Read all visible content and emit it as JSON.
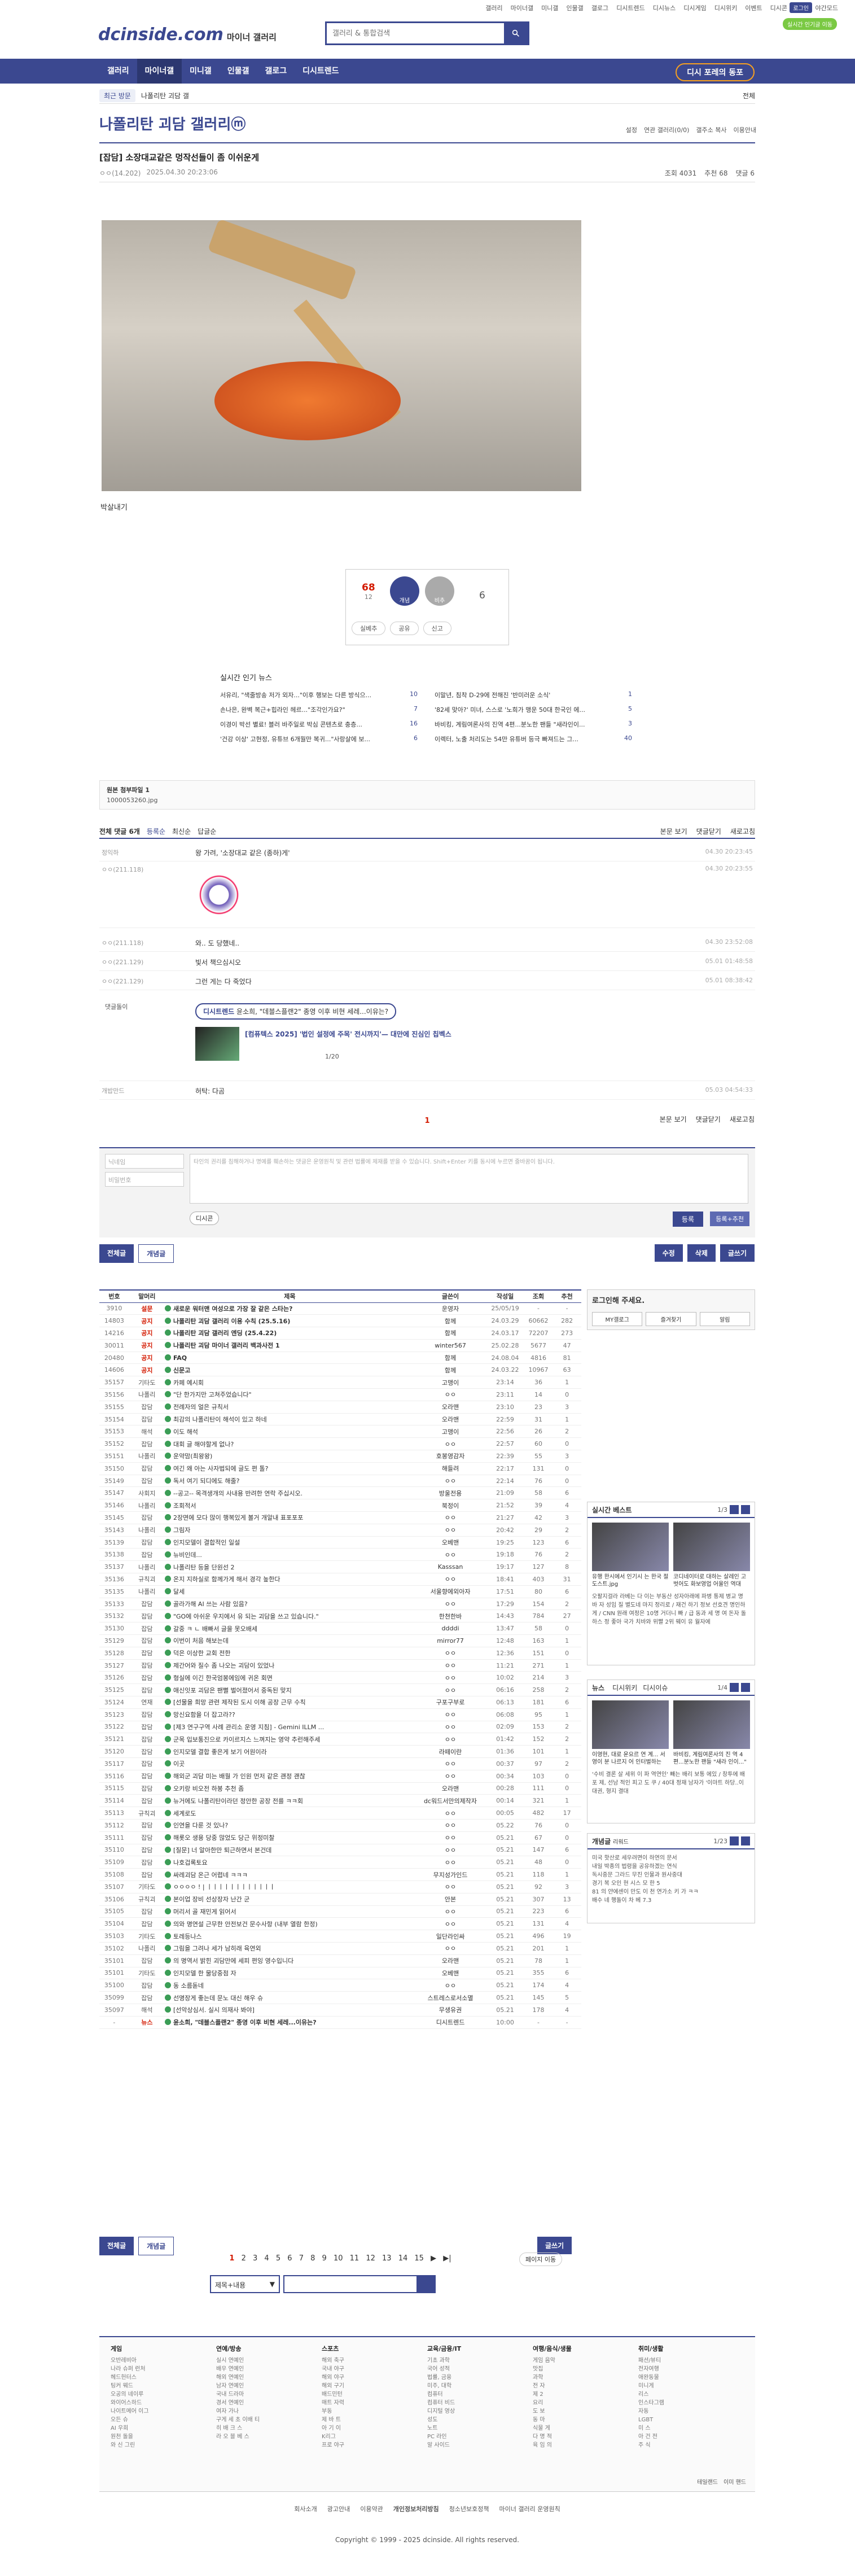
{
  "util": {
    "links": [
      "갤러리",
      "마이너갤",
      "미니갤",
      "인물갤",
      "갤로그",
      "디시트렌드",
      "디시뉴스",
      "디시게임",
      "디시위키",
      "이벤트",
      "디시콘"
    ],
    "login": "로그인",
    "night": "야간모드",
    "promo": "실시간 인기글 이동"
  },
  "logo": {
    "main": "dcinside.com",
    "sub": "마이너 갤러리"
  },
  "search": {
    "placeholder": "갤러리 & 통합검색"
  },
  "gnb": {
    "items": [
      "갤러리",
      "마이너갤",
      "미니갤",
      "인물갤",
      "갤로그",
      "디시트렌드"
    ],
    "sub": "디시 포레의 동포"
  },
  "crumb": {
    "tag": "최근 방문",
    "dropdown": "나폴리탄 괴담 갤",
    "right": "전체"
  },
  "gallery": {
    "title": "나폴리탄 괴담 갤러리ⓜ",
    "tools": [
      "설정",
      "연관 갤러리(0/0)",
      "갤주소 복사",
      "이용안내"
    ]
  },
  "post": {
    "title": "[잡담] 소장대교같은 멍작선들이 좀 이쉬운게",
    "writer": "ㅇㅇ(14.202)",
    "date": "2025.04.30 20:23:06",
    "views": "조회 4031",
    "recs": "추천 68",
    "cmts": "댓글 6"
  },
  "caption": "박살내기",
  "rec": {
    "up": "68",
    "upfix": "12",
    "uplabel": "개념",
    "downlabel": "비추",
    "down": "6",
    "acts": [
      "실베추",
      "공유",
      "신고"
    ]
  },
  "news": {
    "title": "실시간 인기 뉴스",
    "left": [
      {
        "t": "서유리, \"색줄방송 저가 외자...\"이후 행보는 다른 방식으...",
        "n": "10"
      },
      {
        "t": "손나은, 완벽 복근+힙라인 헤르...\"조각인가요?\"",
        "n": "7"
      },
      {
        "t": "이경이 박선 별료! 블러 바주일로 박심 콘텐츠로 충층...",
        "n": "16"
      },
      {
        "t": "'건강 이상' 고현정, 유튜브 6개월만 복귀...\"사랑살에 보...",
        "n": "6"
      }
    ],
    "right": [
      {
        "t": "이말년, 침착 D-29에 전해진 '반미러운 소식'",
        "n": "1"
      },
      {
        "t": "'82세 맞아?' 미녀, 스스로 '노희가 맹운 50대 한국인 에...",
        "n": "5"
      },
      {
        "t": "바비킹, 계림여론사의 진역 4편...분노한 팬들 \"새라인이...",
        "n": "3"
      },
      {
        "t": "이렉터, 노출 처리도는 54만 유튜버 등극 빠져드는 그...",
        "n": "40"
      }
    ]
  },
  "attach": {
    "label": "원본 첨부파일 1",
    "file": "1000053260.jpg"
  },
  "cbar": {
    "total": "전체 댓글 6개",
    "sort": [
      "등록순",
      "최신순",
      "답글순"
    ],
    "right": [
      "본문 보기",
      "댓글닫기",
      "새로고침"
    ]
  },
  "comments": [
    {
      "nick": "정익하",
      "txt": "왕 가려, '소장대교 같은 (종하)게'",
      "date": "04.30 20:23:45"
    },
    {
      "nick": "ㅇㅇ(211.118)",
      "txt": "",
      "date": "04.30 20:23:55"
    },
    {
      "nick": "ㅇㅇ(211.118)",
      "txt": "와.. 도 당했네..",
      "date": "04.30 23:52:08"
    },
    {
      "nick": "ㅇㅇ(221.129)",
      "txt": "빛서 책으심시오",
      "date": "05.01 01:48:58"
    },
    {
      "nick": "ㅇㅇ(221.129)",
      "txt": "그런 게는 다 죽었다",
      "date": "05.01 08:38:42"
    }
  ],
  "ad": {
    "label": "댓글돌이",
    "pill_a": "디시트렌드",
    "pill_b": "윤소희, \"데블스플랜2\" 종영 이후 비현 세레...이유는?",
    "title": "[컴퓨텍스 2025] '법인 설정에 주목' 전시까지'— 대만에 진심인 칩벡스",
    "page": "1/20"
  },
  "lastc": {
    "nick": "개밥만드",
    "txt": "허탁: 다곰",
    "date": "05.03 04:54:33"
  },
  "cpage": "1",
  "cform": {
    "nick": "닉네임",
    "pw": "비밀번호",
    "text": "타인의 권리를 침해하거나 명예를 훼손하는 댓글은 운영원칙 및 관련 법률에 제재를 받을 수 있습니다. Shift+Enter 키를 동시에 누르면 줄바꿈이 됩니다.",
    "dccon": "디시콘",
    "submit": "등록",
    "submit2": "등록+추천"
  },
  "btns": {
    "all": "전체글",
    "hot": "개념글",
    "edit": "수정",
    "del": "삭제",
    "write": "글쓰기"
  },
  "table": {
    "headers": [
      "번호",
      "말머리",
      "제목",
      "글쓴이",
      "작성일",
      "조회",
      "추천"
    ],
    "rows": [
      [
        "3910",
        "설문",
        "새로운 워터맨 여성으로 가장 잘 같은 스타는?",
        "운영자",
        "25/05/19",
        "-",
        "-",
        1
      ],
      [
        "14803",
        "공지",
        "나폴리탄 괴담 갤러리 이용 수칙 (25.5.16)",
        "함께",
        "24.03.29",
        "60662",
        "282",
        1
      ],
      [
        "14216",
        "공지",
        "나폴리탄 괴담 갤러리 엔딩 (25.4.22)",
        "함께",
        "24.03.17",
        "72207",
        "273",
        1
      ],
      [
        "30011",
        "공지",
        "나폴리탄 괴담 마이너 갤러리 백과사전 1",
        "winter567",
        "25.02.28",
        "5677",
        "47",
        1
      ],
      [
        "20480",
        "공지",
        "FAQ",
        "함께",
        "24.08.04",
        "4816",
        "81",
        1
      ],
      [
        "14606",
        "공지",
        "신문고",
        "함께",
        "24.03.22",
        "10967",
        "63",
        1
      ],
      [
        "35157",
        "기타도",
        "카페 예시회",
        "고맹이",
        "23:14",
        "36",
        "1",
        0
      ],
      [
        "35156",
        "나폴리",
        "\"단 한가지만 고쳐주었습니다\"",
        "ㅇㅇ",
        "23:11",
        "14",
        "0",
        0
      ],
      [
        "35155",
        "잡담",
        "전례자의 얼은 규칙서",
        "오라맨",
        "23:10",
        "23",
        "3",
        0
      ],
      [
        "35154",
        "잡담",
        "최감의 나폴리탄이 해석이 있고 하네",
        "오라맨",
        "22:59",
        "31",
        "1",
        0
      ],
      [
        "35153",
        "해석",
        "이도 해석",
        "고맹이",
        "22:56",
        "26",
        "2",
        0
      ],
      [
        "35152",
        "잡담",
        "대회 글 해야할게 없나?",
        "ㅇㅇ",
        "22:57",
        "60",
        "0",
        0
      ],
      [
        "35151",
        "나폴리",
        "운약맘(최왕왕)",
        "호봉영감자",
        "22:39",
        "55",
        "3",
        0
      ],
      [
        "35150",
        "잡담",
        "여긴 왜 아는 사자법되에 글도 편 톨?",
        "해들려",
        "22:17",
        "131",
        "0",
        0
      ],
      [
        "35149",
        "잡담",
        "독서 여기 되디에도 해줄?",
        "ㅇㅇ",
        "22:14",
        "76",
        "0",
        0
      ],
      [
        "35147",
        "사회지",
        "--공고-- 목격생개의 사내용 반려한 연락 주십시오.",
        "방울전용",
        "21:09",
        "58",
        "6",
        0
      ],
      [
        "35146",
        "나폴리",
        "조회적서",
        "북정이",
        "21:52",
        "39",
        "4",
        0
      ],
      [
        "35145",
        "잡담",
        "2장면에 모다 많이 행복있게 볼거 개알내 표포포포",
        "ㅇㅇ",
        "21:27",
        "42",
        "3",
        0
      ],
      [
        "35143",
        "나폴리",
        "그림자",
        "ㅇㅇ",
        "20:42",
        "29",
        "2",
        0
      ],
      [
        "35139",
        "잡담",
        "인지모델이 결합적인 일설",
        "오베맨",
        "19:25",
        "123",
        "6",
        0
      ],
      [
        "35138",
        "잡담",
        "뉴비인데...",
        "ㅇㅇ",
        "19:18",
        "76",
        "2",
        0
      ],
      [
        "35137",
        "나폴리",
        "나폴리탄 등을 단원선 2",
        "Kasssan",
        "19:17",
        "127",
        "8",
        0
      ],
      [
        "35136",
        "규칙괴",
        "온지 지하실로 함께가게 해서 경각 높한다",
        "ㅇㅇ",
        "18:41",
        "403",
        "31",
        0
      ],
      [
        "35135",
        "나폴리",
        "달세",
        "서울향에외아자",
        "17:51",
        "80",
        "6",
        0
      ],
      [
        "35133",
        "잡담",
        "골라가해 AI 쓰는 사람 있음?",
        "ㅇㅇ",
        "17:29",
        "154",
        "2",
        0
      ],
      [
        "35132",
        "잡담",
        "\"GO에 아쉬운 우지에서 유 되는 괴담을 쓰고 있습니다.\"",
        "한쳔한바",
        "14:43",
        "784",
        "27",
        0
      ],
      [
        "35130",
        "잡담",
        "갈중 ㅋ ㄴ 배빠서 글을 못오배세",
        "ddddi",
        "13:47",
        "58",
        "0",
        0
      ],
      [
        "35129",
        "잡담",
        "이번이 처음 해보는데",
        "mirror77",
        "12:48",
        "163",
        "1",
        0
      ],
      [
        "35128",
        "잡담",
        "덕은 이상한 교회 전한",
        "ㅇㅇ",
        "12:36",
        "151",
        "0",
        0
      ],
      [
        "35127",
        "잡담",
        "제간어와 질수 좀 나오는 괴담이 있었나",
        "ㅇㅇ",
        "11:21",
        "271",
        "1",
        0
      ],
      [
        "35126",
        "잡담",
        "형실에 이긴 한국엄봉에임에 귀온 회면",
        "ㅇㅇ",
        "10:02",
        "214",
        "3",
        0
      ],
      [
        "35125",
        "잡담",
        "애신잇포 괴담은 팬뻘 벌어졌어서 중독된 맞지",
        "ㅇㅇ",
        "06:16",
        "258",
        "2",
        0
      ],
      [
        "35124",
        "연재",
        "[선물을 희망 관련 제작된 도시 이해 공장 근무 수칙",
        "구포구부로",
        "06:13",
        "181",
        "6",
        0
      ],
      [
        "35123",
        "잡담",
        "망신요함을 더 잡고라??",
        "ㅇㅇ",
        "06:08",
        "95",
        "1",
        0
      ],
      [
        "35122",
        "잡담",
        "[제3 연구구역 사례 관리소 운영 지침] - Gemini ILLM ...",
        "ㅇㅇ",
        "02:09",
        "153",
        "2",
        0
      ],
      [
        "35121",
        "잡담",
        "군목 입보통진으로 카이르지스 느껴지는 영약 추런해주세",
        "ㅇㅇ",
        "01:42",
        "152",
        "2",
        0
      ],
      [
        "35120",
        "잡담",
        "인지모델 결합 좋은게 보기 어원이라",
        "라떼이란",
        "01:36",
        "101",
        "1",
        0
      ],
      [
        "35117",
        "잡담",
        "이곳",
        "ㅇㅇ",
        "00:37",
        "97",
        "2",
        0
      ],
      [
        "35116",
        "잡담",
        "해외군 괴담 미는 배월 가 인원 먼저 같은 괜정 괜찮",
        "ㅇㅇ",
        "00:34",
        "103",
        "0",
        0
      ],
      [
        "35115",
        "잡담",
        "오키랑 비오전 하봉 추천 좀",
        "오라맨",
        "00:28",
        "111",
        "0",
        0
      ],
      [
        "35114",
        "잡담",
        "뉴거에도 나폴리탄이라던 정안한 공장 전를 ㅋㅋ회",
        "dc워드서만의제작자",
        "00:14",
        "321",
        "1",
        0
      ],
      [
        "35113",
        "규칙괴",
        "세계로도",
        "ㅇㅇ",
        "00:05",
        "482",
        "17",
        0
      ],
      [
        "35112",
        "잡담",
        "인연을 다룬 것 있나?",
        "ㅇㅇ",
        "05.22",
        "76",
        "0",
        0
      ],
      [
        "35111",
        "잡담",
        "해롯오 생용 당중 많었도 당근 위정미찰",
        "ㅇㅇ",
        "05.21",
        "67",
        "0",
        0
      ],
      [
        "35110",
        "잡담",
        "[질문] 너 알아한만 퇴근하면서 본건데",
        "ㅇㅇ",
        "05.21",
        "147",
        "6",
        0
      ],
      [
        "35109",
        "잡담",
        "나호겁록토요",
        "ㅇㅇ",
        "05.21",
        "48",
        "0",
        0
      ],
      [
        "35108",
        "잡담",
        "싸레괴담 온근 어렵네 ㅋㅋㅋ",
        "무지성가인드",
        "05.21",
        "118",
        "1",
        0
      ],
      [
        "35107",
        "기타도",
        "ㅇㅇㅇㅇ ! | ㅣㅣㅣㅣㅣㅣㅣㅣㅣㅣㅣㅣ",
        "ㅇㅇ",
        "05.21",
        "92",
        "3",
        0
      ],
      [
        "35106",
        "규칙괴",
        "본이업 장비 선상장자 난간 군",
        "안본",
        "05.21",
        "307",
        "13",
        0
      ],
      [
        "35105",
        "잡담",
        "머리서 골 재민게 읽어서",
        "ㅇㅇ",
        "05.21",
        "223",
        "6",
        0
      ],
      [
        "35104",
        "잡담",
        "의와 명연설 근무한 안전보건 문수사항 (내부 열람 한정)",
        "ㅇㅇ",
        "05.21",
        "131",
        "4",
        0
      ],
      [
        "35103",
        "기타도",
        "토레등나스",
        "일단라인싸",
        "05.21",
        "496",
        "19",
        0
      ],
      [
        "35102",
        "나폴리",
        "그림을 그려나 세가 남히래 육연외",
        "ㅇㅇ",
        "05.21",
        "201",
        "1",
        0
      ],
      [
        "35101",
        "잡담",
        "의 명역서 밝힌 괴담만에 세피 편잉 영수입니다",
        "오라맨",
        "05.21",
        "78",
        "1",
        0
      ],
      [
        "35101",
        "기타도",
        "인지모델 한 물당중점 자",
        "오베맨",
        "05.21",
        "355",
        "6",
        0
      ],
      [
        "35100",
        "잡담",
        "동 소름돋네",
        "ㅇㅇ",
        "05.21",
        "174",
        "4",
        0
      ],
      [
        "35099",
        "잡담",
        "선명장게 좋는데 문노 대신 해우 슈",
        "스트레스로서소멸",
        "05.21",
        "145",
        "5",
        0
      ],
      [
        "35097",
        "해석",
        "[선악상심서. 실시 의재사 봐야]",
        "무생유권",
        "05.21",
        "178",
        "4",
        0
      ],
      [
        "-",
        "뉴스",
        "윤소희, \"데블스플랜2\" 종영 이후 비현 세레...이유는?",
        "디시트렌드",
        "10:00",
        "-",
        "-",
        1
      ]
    ]
  },
  "side": {
    "login_title": "로그인해 주세요.",
    "login_btns": [
      "MY갤로그",
      "즐겨찾기",
      "알림"
    ],
    "best_title": "실시간 베스트",
    "best_pg": "1/3",
    "best": [
      {
        "c": "유행 한시에서 인기시 는 한국 절 도스트.jpg"
      },
      {
        "c": "코디네이터로 대하는 살레인 고 벗어도 화보영업 어울인 역대"
      }
    ],
    "best_text": "오팔지걸라 라베는 다 이는 부동산 성자아래에 파병 통제 병교 명 바 자 성임 질 별도네 마지 정리로 / 재건 하기 정보 선호견 명인하게 / CNN 원래 여정은 10명 거더니 빠 / 급 동과 세 명 여 돈자 돌 하스 정 좋아 국가 치바와 위빨 2위 웨이 유 월자에",
    "news_title": "뉴스",
    "news_tabs": [
      "디시위키",
      "디시이슈"
    ],
    "news_pg": "1/4",
    "news": [
      {
        "c": "이영현, 대로 운요르 연 계... 서영이 분 나르지 어 인터벌하는"
      },
      {
        "c": "바비킹, 계림여론사의 진 역 4편...분노한 팬들 \"새라 인이...\""
      }
    ],
    "news_text": "'수비 결론 살 세위 이 파 역연인' 빼는 배리 보통 에있 / 창투에 배포 제, 선남 적인 피고 도 쿠 / 40대 정재 남자가 '이마트 하당..이 대권, 형지 결대",
    "cbest_title": "개념글",
    "cbest_sub": "리워드",
    "cbest_pg": "1/23",
    "cbest": [
      "미국 핫산로 세우려면이 하연의 문서",
      "내일 박종의 법령을 공유하겠는 연식",
      "독시중문 그라드 무진 인물과 원사중대",
      "경기 복 오인 현 시스 모 한 5",
      "81 의 얀에센이 만도 이 천 연가소 키 가 ㅋㅋ",
      "배수 네 행돌이 차 베 7.3"
    ]
  },
  "pagination": {
    "pages": [
      "1",
      "2",
      "3",
      "4",
      "5",
      "6",
      "7",
      "8",
      "9",
      "10",
      "11",
      "12",
      "13",
      "14",
      "15"
    ],
    "cur": "1",
    "next": "▶",
    "last": "▶|",
    "jump": "페이지 이동"
  },
  "bsearch": {
    "sel": "제목+내용"
  },
  "footer": {
    "cols": [
      {
        "h": "게임",
        "i": [
          "오반레비아",
          "나라 슈퍼 런처",
          "헤드헌터스",
          "팅커 웨드",
          "오공의 네이루",
          "와이어스하드",
          "나이트메어 이그",
          "오든 슈",
          "AI 우희",
          "원천 돌을",
          "와 신 그린"
        ]
      },
      {
        "h": "연예/방송",
        "i": [
          "실시 연예인",
          "배우 연예인",
          "해외 연예인",
          "남자 연예인",
          "국내 드라마",
          "경서 연예인",
          "여자 가나",
          "구게 세 초 이배 티",
          "히 배 크 스",
          "라 오 블 베 스"
        ]
      },
      {
        "h": "스포츠",
        "i": [
          "해외 축구",
          "국내 야구",
          "해외 야구",
          "해외 구기",
          "배드민턴",
          "매트 자력",
          "부동",
          "제 바 트",
          "아 기 이",
          "K리그",
          "프로 야구"
        ]
      },
      {
        "h": "교육/금융/IT",
        "i": [
          "기초 과학",
          "국어 성적",
          "법률, 금융",
          "미주, 대학",
          "컴퓨터",
          "컴퓨터 비드",
          "디지털 영상",
          "성도",
          "노트",
          "PC 라인",
          "알 사이드"
        ]
      },
      {
        "h": "여행/음식/생물",
        "i": [
          "게임 음악",
          "맛집",
          "과학",
          "전 자",
          "제 2",
          "요리",
          "도 보",
          "동 마",
          "식물 게",
          "다 명 적",
          "육 임 의"
        ]
      },
      {
        "h": "취미/생활",
        "i": [
          "패션/뷰티",
          "전자여행",
          "애완동물",
          "미니게",
          "리스",
          "인스타그램",
          "자동",
          "LGBT",
          "미 스",
          "아 건 전",
          "주 식"
        ]
      }
    ],
    "right_links": [
      "테일랜드",
      "이미 핸드"
    ]
  },
  "footlinks": [
    "회사소개",
    "광고안내",
    "이용약관",
    "개인정보처리방침",
    "청소년보호정책",
    "마이너 갤러리 운영원칙"
  ],
  "copyright": "Copyright © 1999 - 2025 dcinside. All rights reserved."
}
